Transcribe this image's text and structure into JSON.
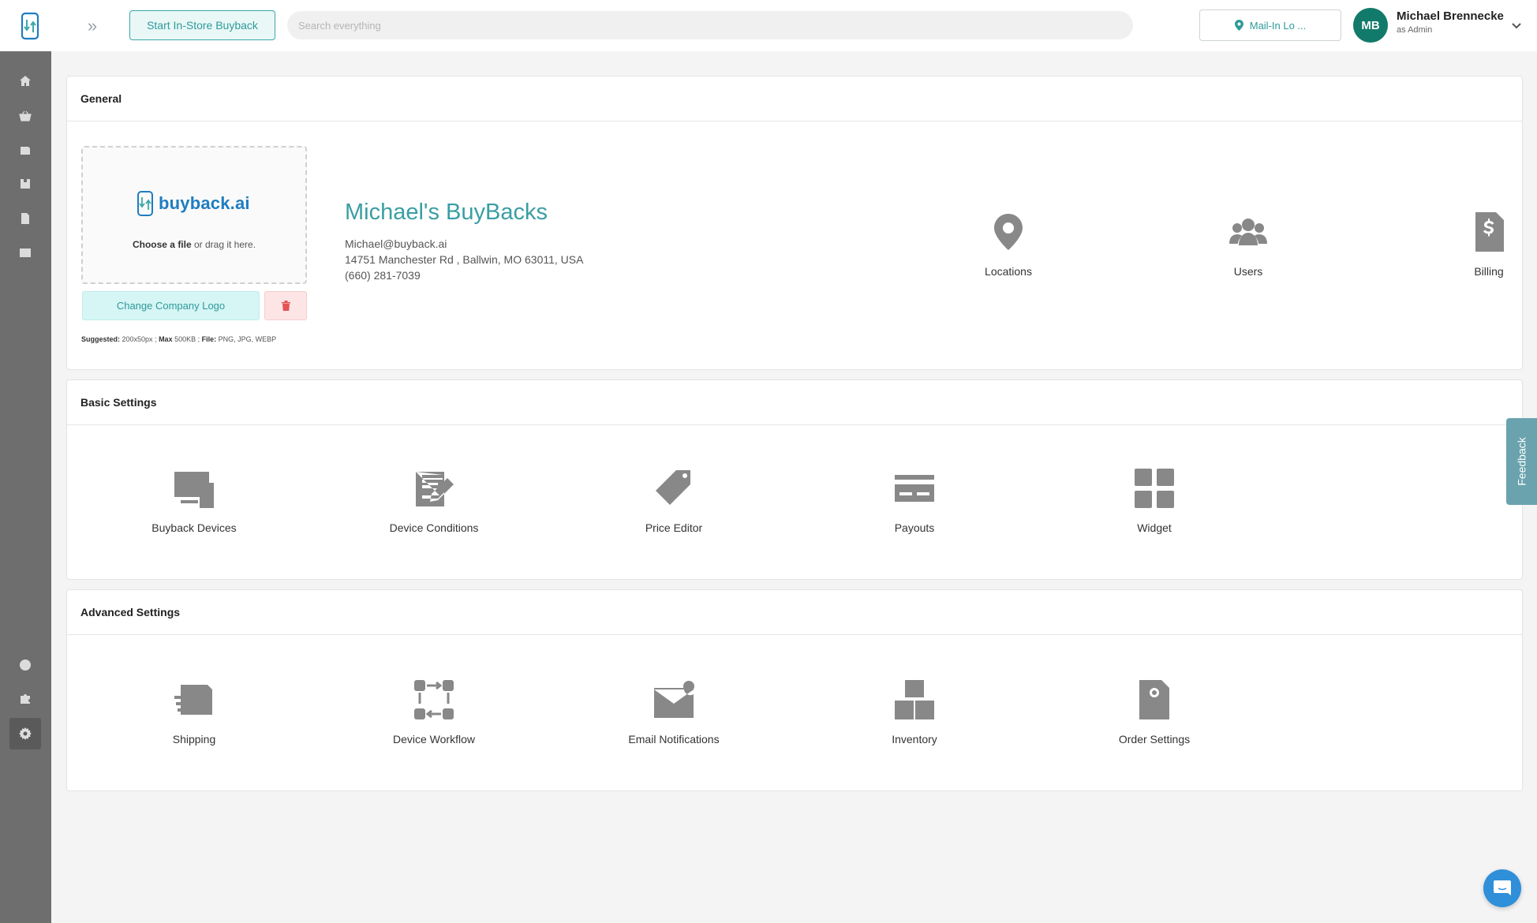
{
  "topbar": {
    "start_buyback_label": "Start In-Store Buyback",
    "search_placeholder": "Search everything",
    "location_label": "Mail-In Lo ...",
    "user": {
      "initials": "MB",
      "name": "Michael Brennecke",
      "role": "as Admin"
    }
  },
  "sidebar": {
    "items": [
      {
        "name": "home-icon"
      },
      {
        "name": "basket-icon"
      },
      {
        "name": "box-icon"
      },
      {
        "name": "archive-icon"
      },
      {
        "name": "document-icon"
      },
      {
        "name": "id-card-icon"
      },
      {
        "name": "help-icon"
      },
      {
        "name": "puzzle-icon"
      },
      {
        "name": "settings-icon",
        "active": true
      }
    ]
  },
  "general": {
    "title": "General",
    "logo_text": "buyback.ai",
    "drop_hint_bold": "Choose a file",
    "drop_hint_rest": " or drag it here.",
    "change_logo_label": "Change Company Logo",
    "specs": {
      "suggested_label": "Suggested:",
      "suggested_value": " 200x50px ; ",
      "max_label": "Max",
      "max_value": " 500KB ; ",
      "file_label": "File:",
      "file_value": " PNG, JPG, WEBP"
    },
    "company": {
      "name": "Michael's BuyBacks",
      "email": "Michael@buyback.ai",
      "address": "14751 Manchester Rd , Ballwin, MO 63011, USA",
      "phone": "(660) 281-7039"
    },
    "tiles": [
      {
        "label": "Locations",
        "icon": "location-pin-icon"
      },
      {
        "label": "Users",
        "icon": "users-icon"
      },
      {
        "label": "Billing",
        "icon": "billing-icon"
      }
    ]
  },
  "basic": {
    "title": "Basic Settings",
    "tiles": [
      {
        "label": "Buyback Devices",
        "icon": "devices-icon"
      },
      {
        "label": "Device Conditions",
        "icon": "edit-form-icon"
      },
      {
        "label": "Price Editor",
        "icon": "price-tag-icon"
      },
      {
        "label": "Payouts",
        "icon": "credit-card-icon"
      },
      {
        "label": "Widget",
        "icon": "widget-grid-icon"
      }
    ]
  },
  "advanced": {
    "title": "Advanced Settings",
    "tiles": [
      {
        "label": "Shipping",
        "icon": "shipping-box-icon"
      },
      {
        "label": "Device Workflow",
        "icon": "workflow-icon"
      },
      {
        "label": "Email Notifications",
        "icon": "email-notification-icon"
      },
      {
        "label": "Inventory",
        "icon": "inventory-icon"
      },
      {
        "label": "Order Settings",
        "icon": "order-settings-icon"
      }
    ]
  },
  "feedback_label": "Feedback",
  "colors": {
    "brand_teal": "#3a9ea3",
    "avatar": "#127a6a",
    "sidebar": "#6e6e6e",
    "chat": "#2f8fd9"
  }
}
